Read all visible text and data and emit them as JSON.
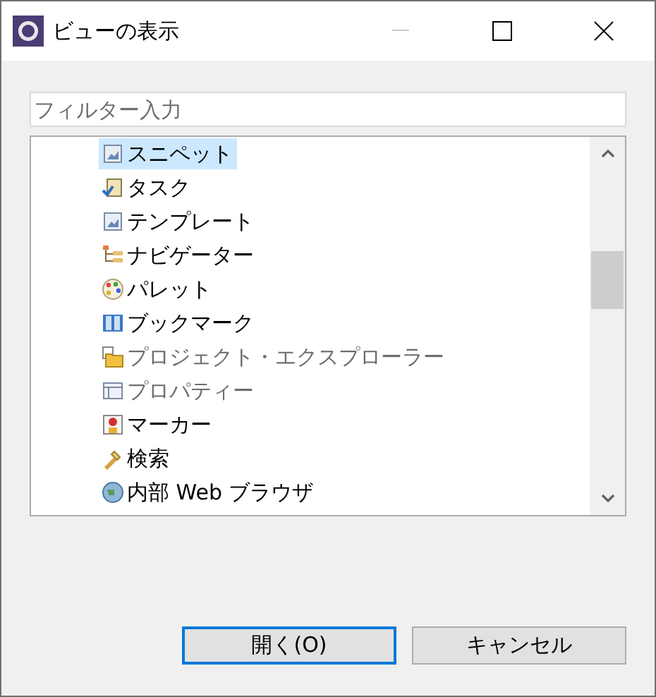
{
  "window": {
    "title": "ビューの表示"
  },
  "filter": {
    "placeholder": "フィルター入力"
  },
  "views": [
    {
      "label": "スニペット",
      "kind": "snippet",
      "selected": true,
      "disabled": false
    },
    {
      "label": "タスク",
      "kind": "task",
      "selected": false,
      "disabled": false
    },
    {
      "label": "テンプレート",
      "kind": "snippet",
      "selected": false,
      "disabled": false
    },
    {
      "label": "ナビゲーター",
      "kind": "navigator",
      "selected": false,
      "disabled": false
    },
    {
      "label": "パレット",
      "kind": "palette",
      "selected": false,
      "disabled": false
    },
    {
      "label": "ブックマーク",
      "kind": "book",
      "selected": false,
      "disabled": false
    },
    {
      "label": "プロジェクト・エクスプローラー",
      "kind": "folder",
      "selected": false,
      "disabled": true
    },
    {
      "label": "プロパティー",
      "kind": "table",
      "selected": false,
      "disabled": true
    },
    {
      "label": "マーカー",
      "kind": "marker",
      "selected": false,
      "disabled": false
    },
    {
      "label": "検索",
      "kind": "search",
      "selected": false,
      "disabled": false
    },
    {
      "label": "内部 Web ブラウザ",
      "kind": "globe",
      "selected": false,
      "disabled": false
    }
  ],
  "buttons": [
    {
      "label": "開く(O)",
      "default": true
    },
    {
      "label": "キャンセル",
      "default": false
    }
  ]
}
